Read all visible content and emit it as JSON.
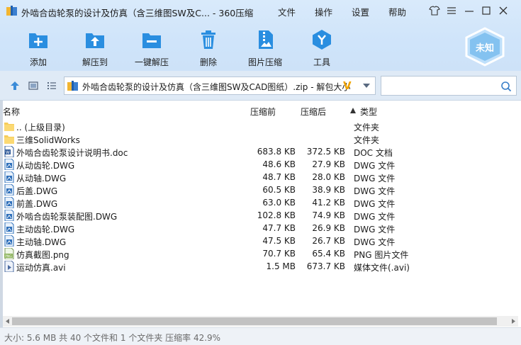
{
  "window": {
    "title": "外啮合齿轮泵的设计及仿真（含三维图SW及C... - 360压缩",
    "menu": [
      "文件",
      "操作",
      "设置",
      "帮助"
    ]
  },
  "toolbar": [
    {
      "label": "添加",
      "icon": "add-icon"
    },
    {
      "label": "解压到",
      "icon": "extract-to-icon"
    },
    {
      "label": "一键解压",
      "icon": "one-click-extract-icon"
    },
    {
      "label": "删除",
      "icon": "trash-icon"
    },
    {
      "label": "图片压缩",
      "icon": "image-compress-icon"
    },
    {
      "label": "工具",
      "icon": "tools-icon"
    }
  ],
  "badge": {
    "label": "未知"
  },
  "address": {
    "path": "外啮合齿轮泵的设计及仿真（含三维图SW及CAD图纸）.zip - 解包大小",
    "v_mark": "V"
  },
  "search": {
    "placeholder": ""
  },
  "columns": {
    "name": "名称",
    "size": "压缩前",
    "packed": "压缩后",
    "type": "类型"
  },
  "files": [
    {
      "name": ".. (上级目录)",
      "size": "",
      "packed": "",
      "type": "文件夹",
      "kind": "folder"
    },
    {
      "name": "三维SolidWorks",
      "size": "",
      "packed": "",
      "type": "文件夹",
      "kind": "folder"
    },
    {
      "name": "外啮合齿轮泵设计说明书.doc",
      "size": "683.8 KB",
      "packed": "372.5 KB",
      "type": "DOC 文档",
      "kind": "doc"
    },
    {
      "name": "从动齿轮.DWG",
      "size": "48.6 KB",
      "packed": "27.9 KB",
      "type": "DWG 文件",
      "kind": "dwg"
    },
    {
      "name": "从动轴.DWG",
      "size": "48.7 KB",
      "packed": "28.0 KB",
      "type": "DWG 文件",
      "kind": "dwg"
    },
    {
      "name": "后盖.DWG",
      "size": "60.5 KB",
      "packed": "38.9 KB",
      "type": "DWG 文件",
      "kind": "dwg"
    },
    {
      "name": "前盖.DWG",
      "size": "63.0 KB",
      "packed": "41.2 KB",
      "type": "DWG 文件",
      "kind": "dwg"
    },
    {
      "name": "外啮合齿轮泵装配图.DWG",
      "size": "102.8 KB",
      "packed": "74.9 KB",
      "type": "DWG 文件",
      "kind": "dwg"
    },
    {
      "name": "主动齿轮.DWG",
      "size": "47.7 KB",
      "packed": "26.9 KB",
      "type": "DWG 文件",
      "kind": "dwg"
    },
    {
      "name": "主动轴.DWG",
      "size": "47.5 KB",
      "packed": "26.7 KB",
      "type": "DWG 文件",
      "kind": "dwg"
    },
    {
      "name": "仿真截图.png",
      "size": "70.7 KB",
      "packed": "65.4 KB",
      "type": "PNG 图片文件",
      "kind": "png"
    },
    {
      "name": "运动仿真.avi",
      "size": "1.5 MB",
      "packed": "673.7 KB",
      "type": "媒体文件(.avi)",
      "kind": "avi"
    }
  ],
  "status": "大小: 5.6 MB 共 40 个文件和 1 个文件夹 压缩率 42.9%",
  "colors": {
    "accent": "#2a8ee0",
    "titlebar": "#d9eafb"
  }
}
